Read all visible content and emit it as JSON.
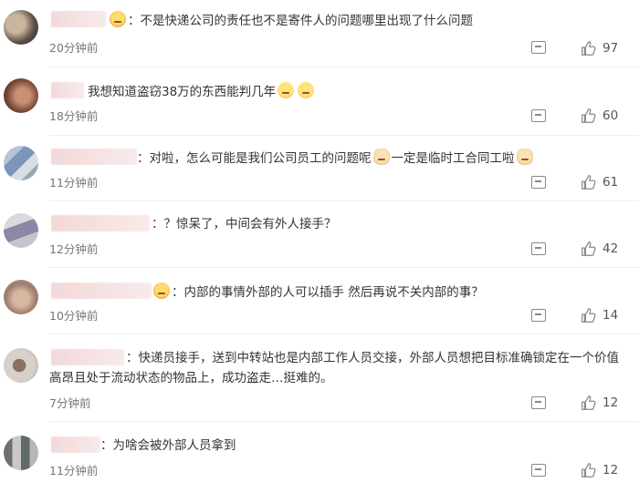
{
  "comments": [
    {
      "text_before": "：不是快递公司的责任也不是寄件人的问题哪里出现了什么问题",
      "text_after": "",
      "time": "20分钟前",
      "likes": "97"
    },
    {
      "text_before": "我想知道盗窃38万的东西能判几年",
      "text_after": "",
      "time": "18分钟前",
      "likes": "60"
    },
    {
      "text_before": "：对啦，怎么可能是我们公司员工的问题呢",
      "text_after": "一定是临时工合同工啦",
      "time": "11分钟前",
      "likes": "61"
    },
    {
      "text_before": "：？惊呆了，中间会有外人接手？",
      "text_after": "",
      "time": "12分钟前",
      "likes": "42"
    },
    {
      "text_before": "：内部的事情外部的人可以插手 然后再说不关内部的事？",
      "text_after": "",
      "time": "10分钟前",
      "likes": "14"
    },
    {
      "text_before": "：快递员接手，送到中转站也是内部工作人员交接，外部人员想把目标准确锁定在一个价值",
      "text_after": "高昂且处于流动状态的物品上，成功盗走…挺难的。",
      "time": "7分钟前",
      "likes": "12"
    },
    {
      "text_before": "：为啥会被外部人员拿到",
      "text_after": "",
      "time": "11分钟前",
      "likes": "12"
    }
  ]
}
